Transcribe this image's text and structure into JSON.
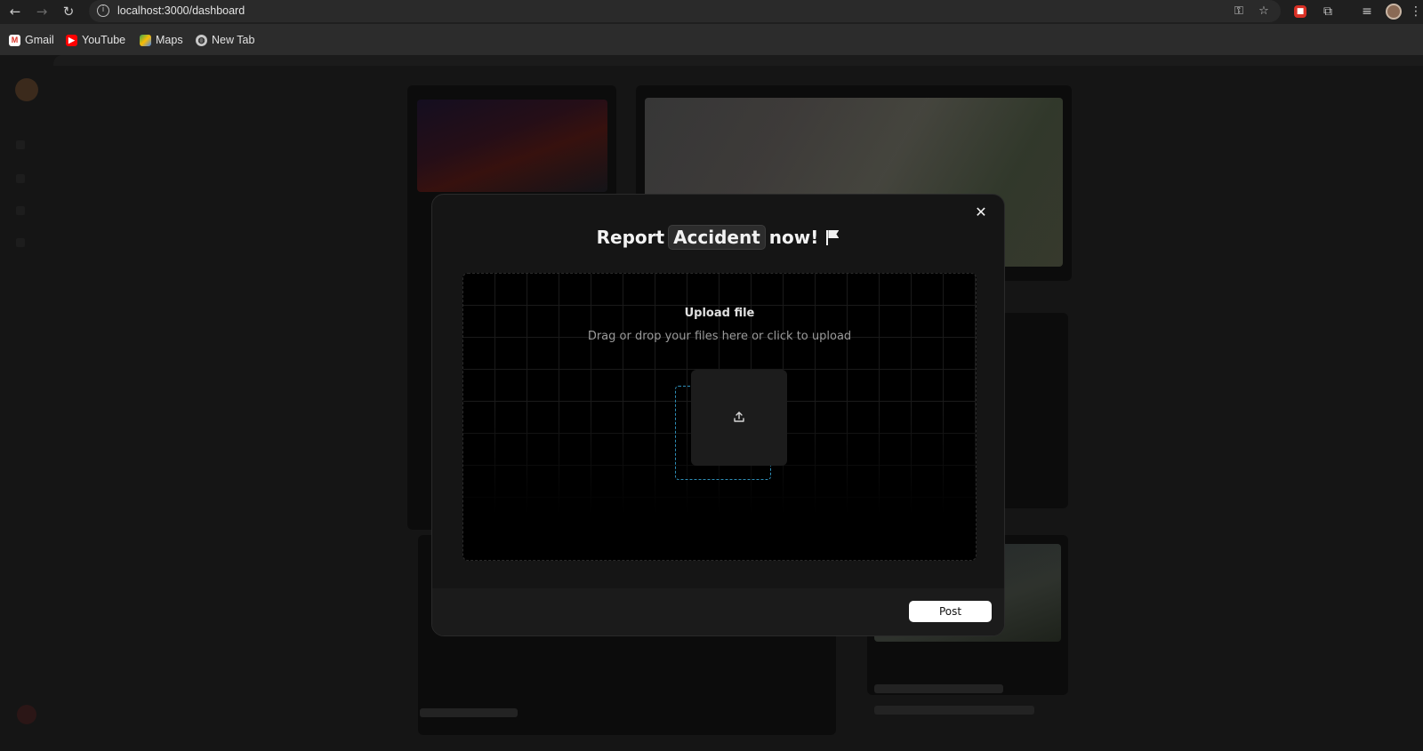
{
  "browser": {
    "url": "localhost:3000/dashboard",
    "bookmarks": [
      {
        "label": "Gmail",
        "icon": "gmail-icon"
      },
      {
        "label": "YouTube",
        "icon": "youtube-icon"
      },
      {
        "label": "Maps",
        "icon": "maps-icon"
      },
      {
        "label": "New Tab",
        "icon": "globe-icon"
      }
    ]
  },
  "modal": {
    "title_prefix": "Report",
    "title_highlight": "Accident",
    "title_suffix": "now!",
    "upload": {
      "title": "Upload file",
      "subtitle": "Drag or drop your files here or click to upload"
    },
    "post_label": "Post"
  },
  "colors": {
    "accent_outline": "#2f8fb8",
    "modal_bg": "#151515",
    "button_bg": "#ffffff"
  }
}
